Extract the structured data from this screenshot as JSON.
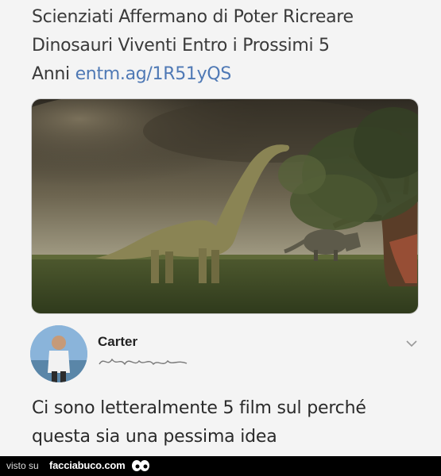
{
  "headline": {
    "line1": "Scienziati Affermano di Poter Ricreare",
    "line2": "Dinosauri Viventi Entro i Prossimi 5",
    "line3_prefix": "Anni",
    "link": "entm.ag/1R51yQS"
  },
  "reply": {
    "author": "Carter",
    "line1": "Ci sono letteralmente 5 film sul perché",
    "line2": "questa sia una pessima idea"
  },
  "footer": {
    "visto": "visto su",
    "brand": "facciabuco.com"
  },
  "icons": {
    "reply_menu": "chevron-down-icon",
    "footer_logo": "eyes-icon"
  },
  "colors": {
    "link": "#4f79b5",
    "footer_bg": "#000000"
  }
}
